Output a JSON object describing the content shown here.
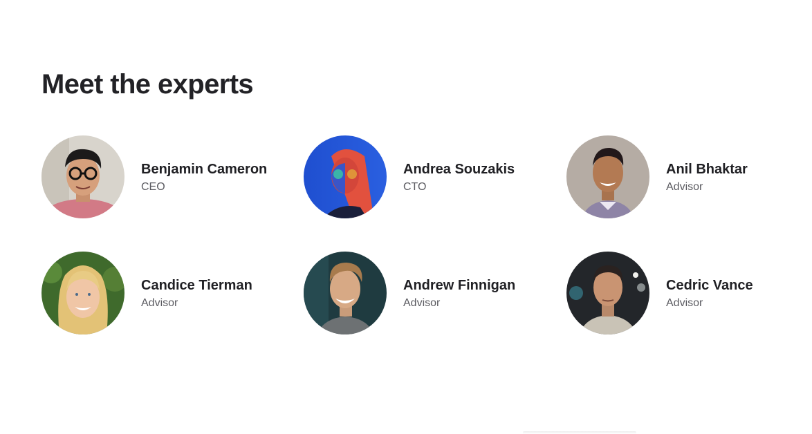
{
  "section": {
    "title": "Meet the experts"
  },
  "experts": [
    {
      "name": "Benjamin Cameron",
      "role": "CEO"
    },
    {
      "name": "Andrea Souzakis",
      "role": "CTO"
    },
    {
      "name": "Anil Bhaktar",
      "role": "Advisor"
    },
    {
      "name": "Candice Tierman",
      "role": "Advisor"
    },
    {
      "name": "Andrew Finnigan",
      "role": "Advisor"
    },
    {
      "name": "Cedric Vance",
      "role": "Advisor"
    }
  ],
  "colors": {
    "text": "#222226",
    "muted": "#5b5b61",
    "background": "#ffffff"
  }
}
